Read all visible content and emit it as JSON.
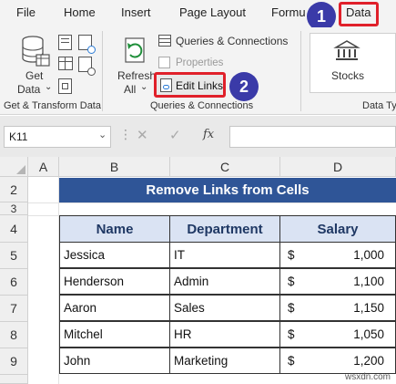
{
  "menu": {
    "tabs": [
      "File",
      "Home",
      "Insert",
      "Page Layout",
      "Formu",
      "Data"
    ]
  },
  "ribbon": {
    "get_data_line1": "Get",
    "get_data_line2": "Data",
    "refresh_line1": "Refresh",
    "refresh_line2": "All",
    "queries_connections": "Queries & Connections",
    "properties": "Properties",
    "edit_links": "Edit Links",
    "stocks": "Stocks",
    "group_get_transform": "Get & Transform Data",
    "group_queries": "Queries & Connections",
    "group_datatypes": "Data Ty"
  },
  "badges": {
    "one": "1",
    "two": "2"
  },
  "formula_bar": {
    "name_box": "K11",
    "fx": "fx"
  },
  "grid": {
    "columns": [
      "A",
      "B",
      "C",
      "D"
    ],
    "rows": [
      "2",
      "3",
      "4",
      "5",
      "6",
      "7",
      "8",
      "9"
    ],
    "title": "Remove Links from Cells",
    "headers": [
      "Name",
      "Department",
      "Salary"
    ],
    "data": [
      {
        "name": "Jessica",
        "dept": "IT",
        "currency": "$",
        "salary": "1,000"
      },
      {
        "name": "Henderson",
        "dept": "Admin",
        "currency": "$",
        "salary": "1,100"
      },
      {
        "name": "Aaron",
        "dept": "Sales",
        "currency": "$",
        "salary": "1,150"
      },
      {
        "name": "Mitchel",
        "dept": "HR",
        "currency": "$",
        "salary": "1,050"
      },
      {
        "name": "John",
        "dept": "Marketing",
        "currency": "$",
        "salary": "1,200"
      }
    ]
  },
  "watermark": "wsxdn.com",
  "colors": {
    "accent_red": "#e0202a",
    "badge_blue": "#3a3aa8",
    "title_blue": "#2f5597",
    "header_fill": "#dae3f3"
  }
}
